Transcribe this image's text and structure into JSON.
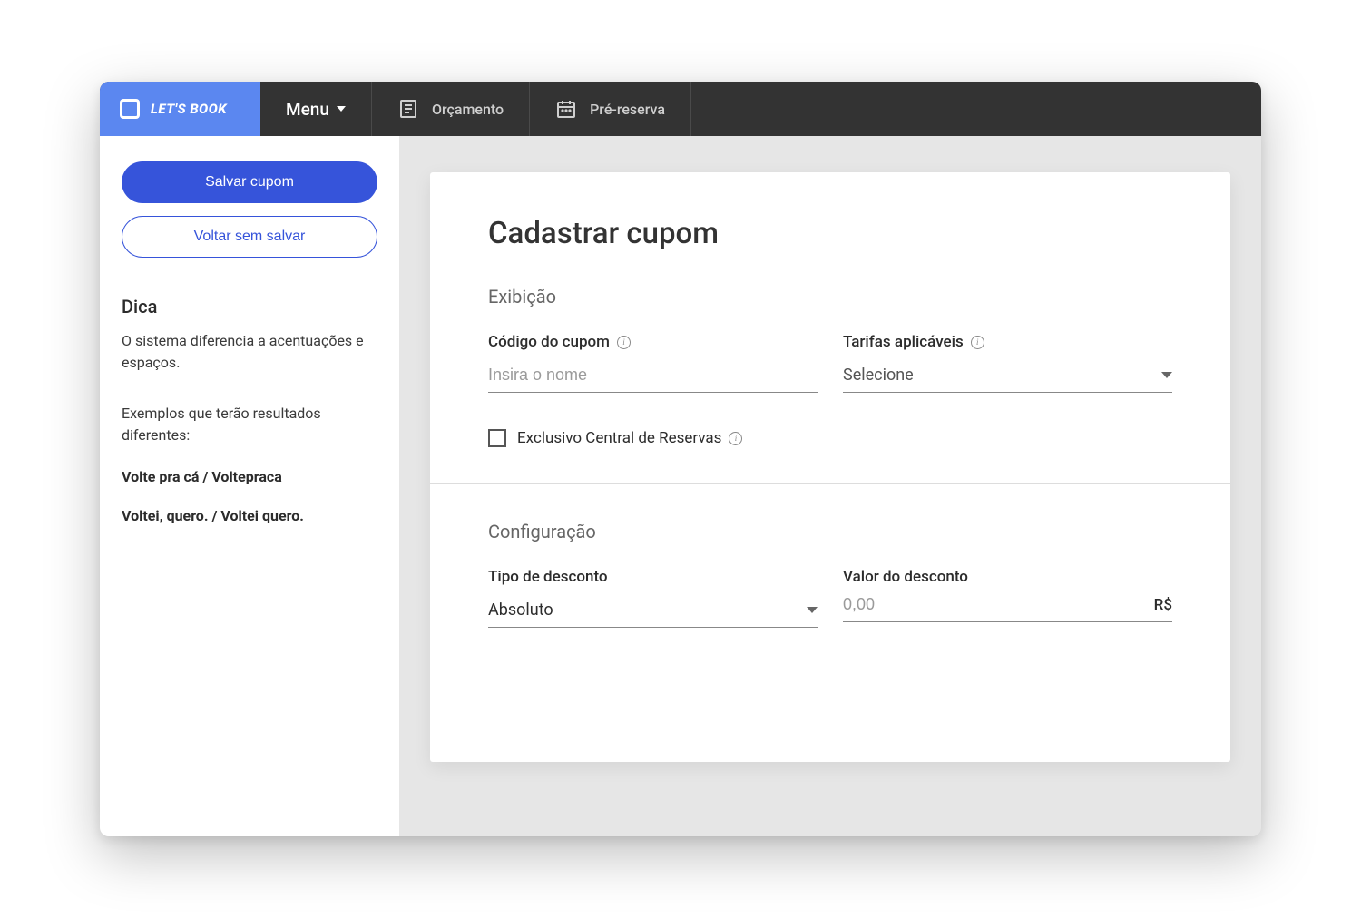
{
  "header": {
    "logo_text": "LET'S BOOK",
    "menu_label": "Menu",
    "nav": [
      {
        "label": "Orçamento"
      },
      {
        "label": "Pré-reserva"
      }
    ]
  },
  "sidebar": {
    "save_label": "Salvar cupom",
    "back_label": "Voltar sem salvar",
    "tip_title": "Dica",
    "tip_text": "O sistema diferencia a acentuações e espaços.",
    "tip_examples_intro": "Exemplos que terão resultados diferentes:",
    "tip_example_1": "Volte pra cá / Voltepraca",
    "tip_example_2": "Voltei, quero. / Voltei quero."
  },
  "main": {
    "title": "Cadastrar cupom",
    "section_display": "Exibição",
    "coupon_code_label": "Código do cupom",
    "coupon_code_placeholder": "Insira o nome",
    "rates_label": "Tarifas aplicáveis",
    "rates_placeholder": "Selecione",
    "exclusive_label": "Exclusivo Central de Reservas",
    "section_config": "Configuração",
    "discount_type_label": "Tipo de desconto",
    "discount_type_value": "Absoluto",
    "discount_value_label": "Valor do desconto",
    "discount_value_placeholder": "0,00",
    "currency_suffix": "R$"
  }
}
